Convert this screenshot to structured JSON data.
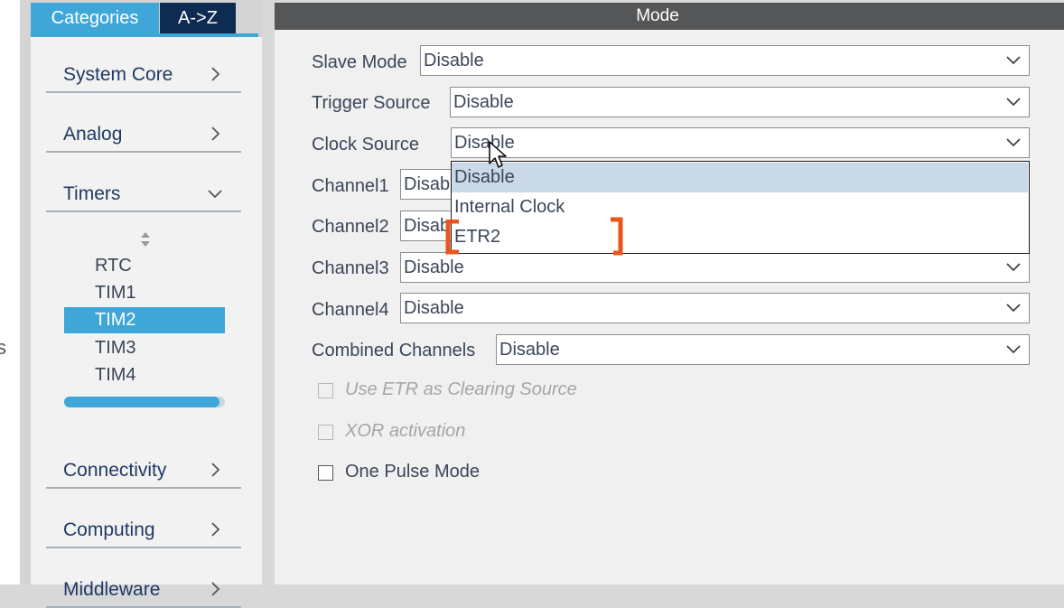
{
  "sidebar": {
    "tabs": [
      {
        "label": "Categories",
        "active": true
      },
      {
        "label": "A->Z",
        "active": false
      }
    ],
    "categories": [
      {
        "label": "System Core",
        "icon": "chevron-right-icon"
      },
      {
        "label": "Analog",
        "icon": "chevron-right-icon"
      },
      {
        "label": "Timers",
        "icon": "chevron-down-icon",
        "expanded": true
      },
      {
        "label": "Connectivity",
        "icon": "chevron-right-icon"
      },
      {
        "label": "Computing",
        "icon": "chevron-right-icon"
      },
      {
        "label": "Middleware",
        "icon": "chevron-right-icon"
      }
    ],
    "timers": [
      "RTC",
      "TIM1",
      "TIM2",
      "TIM3",
      "TIM4"
    ],
    "selected_timer": "TIM2"
  },
  "edge_char": "s",
  "mode": {
    "header": "Mode",
    "fields": [
      {
        "label": "Slave Mode",
        "value": "Disable"
      },
      {
        "label": "Trigger Source",
        "value": "Disable"
      },
      {
        "label": "Clock Source",
        "value": "Disable"
      },
      {
        "label": "Channel1",
        "value": "Disable"
      },
      {
        "label": "Channel2",
        "value": "Disable"
      },
      {
        "label": "Channel3",
        "value": "Disable"
      },
      {
        "label": "Channel4",
        "value": "Disable"
      },
      {
        "label": "Combined Channels",
        "value": "Disable"
      }
    ],
    "clock_source_options": [
      "Disable",
      "Internal Clock",
      "ETR2"
    ],
    "highlighted_option": "Disable",
    "checkboxes": [
      {
        "label": "Use ETR as Clearing Source",
        "enabled": false,
        "checked": false
      },
      {
        "label": "XOR activation",
        "enabled": false,
        "checked": false
      },
      {
        "label": "One Pulse Mode",
        "enabled": true,
        "checked": false
      }
    ]
  },
  "colors": {
    "accent": "#3fa6d8",
    "tab_dark": "#0e2b52",
    "header": "#555658",
    "annotation": "#e8561c",
    "highlight": "#c9d9e8"
  }
}
